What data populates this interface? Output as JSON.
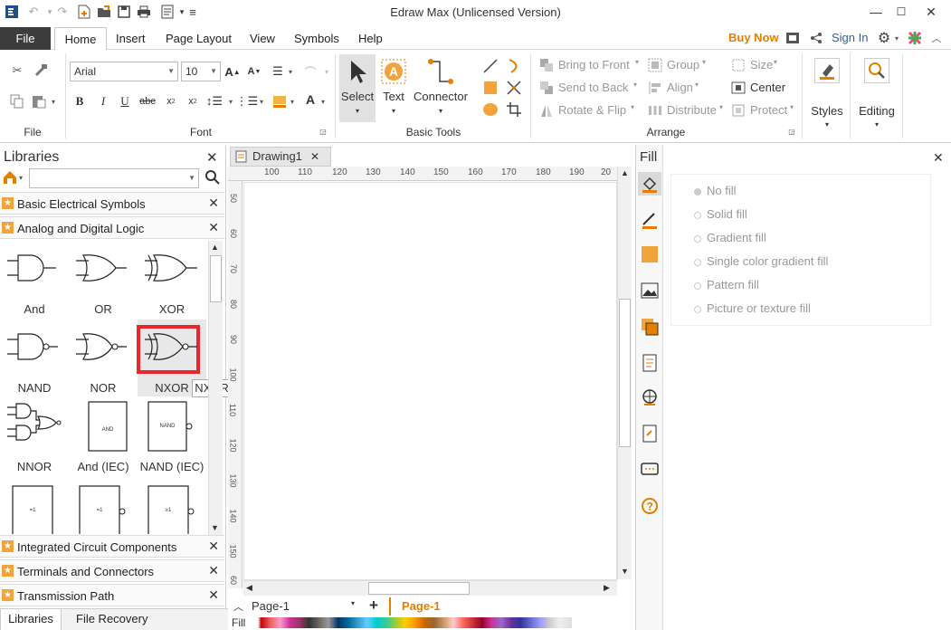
{
  "app": {
    "title": "Edraw Max (Unlicensed Version)"
  },
  "menu": {
    "file": "File",
    "tabs": [
      "Home",
      "Insert",
      "Page Layout",
      "View",
      "Symbols",
      "Help"
    ],
    "buy_now": "Buy Now",
    "sign_in": "Sign In"
  },
  "ribbon": {
    "groups": {
      "file": "File",
      "font": "Font",
      "basic_tools": "Basic Tools",
      "arrange": "Arrange"
    },
    "font_name": "Arial",
    "font_size": "10",
    "tools": {
      "select": "Select",
      "text": "Text",
      "connector": "Connector"
    },
    "arrange": {
      "bring_to_front": "Bring to Front",
      "send_to_back": "Send to Back",
      "rotate_flip": "Rotate & Flip",
      "group": "Group",
      "align": "Align",
      "distribute": "Distribute",
      "size": "Size",
      "center": "Center",
      "protect": "Protect"
    },
    "styles": "Styles",
    "editing": "Editing"
  },
  "libraries": {
    "title": "Libraries",
    "categories_top": [
      "Basic Electrical Symbols",
      "Analog and Digital Logic"
    ],
    "shapes": [
      {
        "label": "And",
        "kind": "and"
      },
      {
        "label": "OR",
        "kind": "or"
      },
      {
        "label": "XOR",
        "kind": "xor"
      },
      {
        "label": "NAND",
        "kind": "nand"
      },
      {
        "label": "NOR",
        "kind": "nor"
      },
      {
        "label": "NXOR",
        "kind": "nxor"
      },
      {
        "label": "NNOR",
        "kind": "nnor"
      },
      {
        "label": "And (IEC)",
        "kind": "and-iec",
        "inner": "AND"
      },
      {
        "label": "NAND (IEC)",
        "kind": "nand-iec",
        "inner": "NAND"
      },
      {
        "label": "",
        "kind": "box1",
        "inner": "=1"
      },
      {
        "label": "",
        "kind": "box2",
        "inner": "=1"
      },
      {
        "label": "",
        "kind": "box3",
        "inner": "≥1"
      }
    ],
    "tooltip": "NXOR",
    "categories_bottom": [
      "Integrated Circuit Components",
      "Terminals and Connectors",
      "Transmission Path"
    ]
  },
  "document": {
    "tab": "Drawing1",
    "ruler_h": [
      "100",
      "110",
      "120",
      "130",
      "140",
      "150",
      "160",
      "170",
      "180",
      "190",
      "20"
    ],
    "ruler_v": [
      "50",
      "60",
      "70",
      "80",
      "90",
      "100",
      "110",
      "120",
      "130",
      "140",
      "150",
      "60"
    ],
    "page_select": "Page-1",
    "page_active": "Page-1"
  },
  "bottom": {
    "tabs": [
      "Libraries",
      "File Recovery"
    ],
    "fill_label": "Fill"
  },
  "fill_panel": {
    "title": "Fill",
    "options": [
      "No fill",
      "Solid fill",
      "Gradient fill",
      "Single color gradient fill",
      "Pattern fill",
      "Picture or texture fill"
    ]
  },
  "colors": {
    "accent": "#e67e00",
    "highlight": "#e8262b",
    "file_tab": "#3c3c3c",
    "link": "#2d5fa5"
  }
}
